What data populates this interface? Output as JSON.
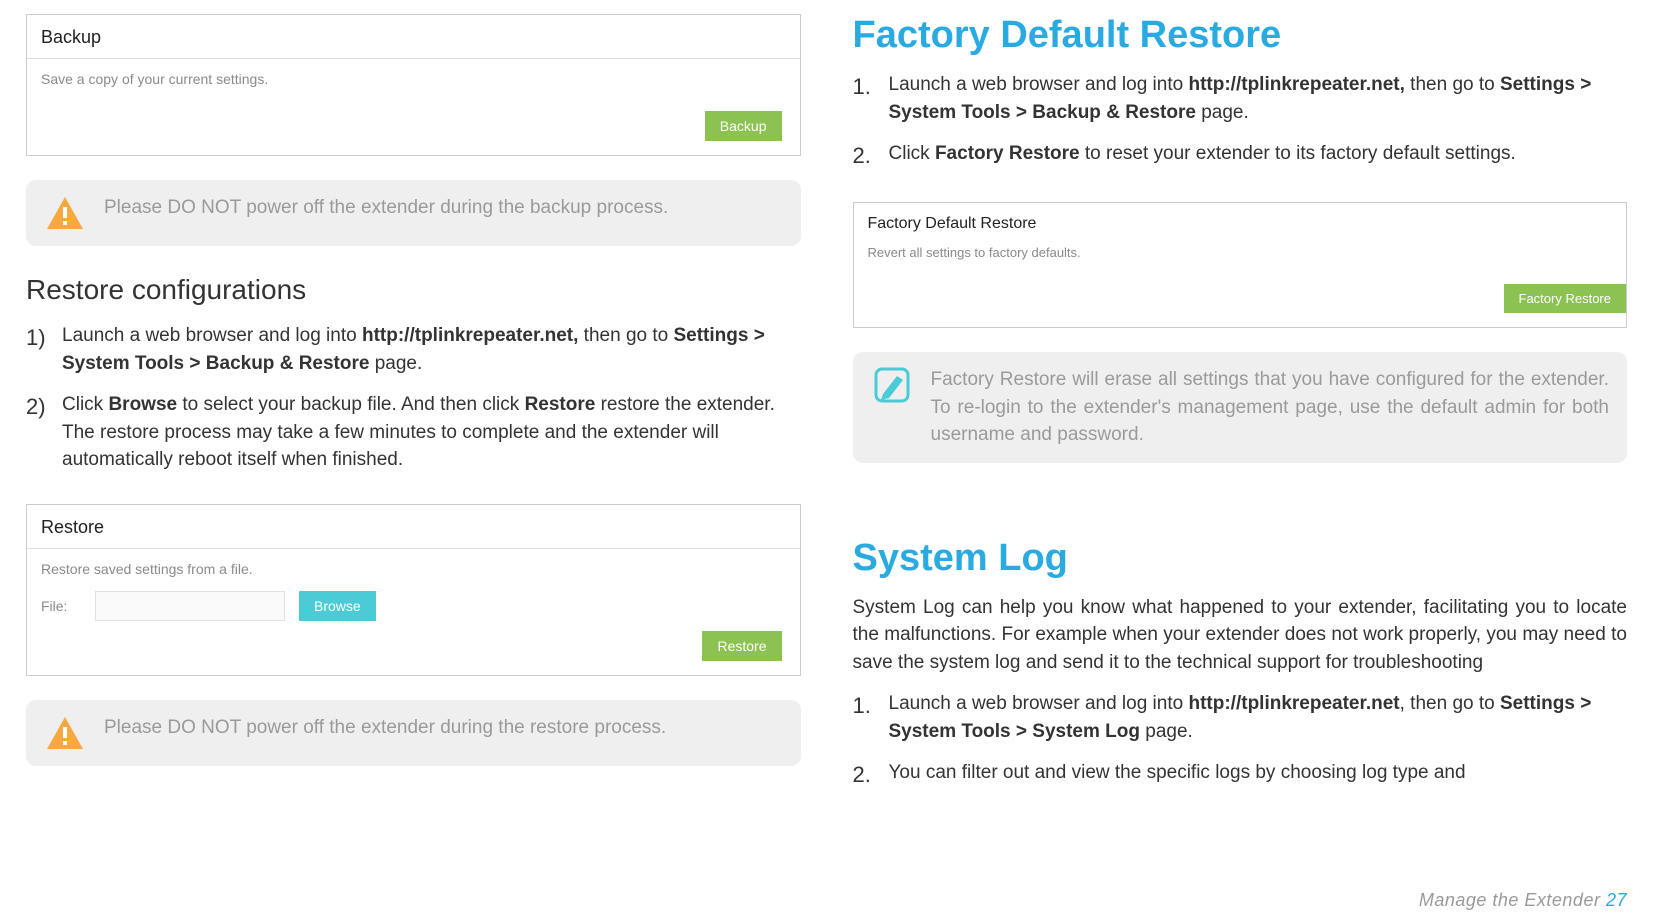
{
  "left": {
    "backup_panel": {
      "header": "Backup",
      "desc": "Save a copy of your current settings.",
      "button": "Backup"
    },
    "backup_warning": "Please DO NOT power off the extender during the backup process.",
    "restore_heading": "Restore configurations",
    "restore_steps": {
      "s1_num": "1)",
      "s1_a": "Launch a web browser and log into ",
      "s1_url": "http://tplinkrepeater.net,",
      "s1_b": " then go to ",
      "s1_path": "Settings > System Tools > Backup & Restore",
      "s1_c": " page.",
      "s2_num": "2)",
      "s2_a": "Click ",
      "s2_b1": "Browse",
      "s2_c": " to select your backup file. And then click ",
      "s2_b2": "Restore",
      "s2_d": " restore the extender. The restore process may take a few minutes to complete and the extender will automatically reboot itself when finished."
    },
    "restore_panel": {
      "header": "Restore",
      "desc": "Restore saved settings from a file.",
      "file_label": "File:",
      "browse": "Browse",
      "restore": "Restore"
    },
    "restore_warning": "Please DO NOT power off the extender during the restore process."
  },
  "right": {
    "fdr_heading": "Factory Default Restore",
    "fdr_steps": {
      "s1_num": "1.",
      "s1_a": "Launch a web browser and log into ",
      "s1_url": "http://tplinkrepeater.net,",
      "s1_b": " then go to ",
      "s1_path": "Settings > System Tools > Backup & Restore",
      "s1_c": " page.",
      "s2_num": "2.",
      "s2_a": "Click ",
      "s2_b1": "Factory Restore",
      "s2_c": " to reset your extender to its factory default settings."
    },
    "fdr_panel": {
      "header": "Factory Default Restore",
      "desc": "Revert all settings to factory defaults.",
      "button": "Factory Restore"
    },
    "fdr_note": "Factory Restore will erase all settings that you have configured for the extender. To re-login to the extender's management page, use the default admin for both username and password.",
    "syslog_heading": "System Log",
    "syslog_desc": "System Log can help you know what happened to your extender, facilitating you to locate the malfunctions. For example when your extender does not work properly, you may need to save the system log and send it to the technical support for troubleshooting",
    "syslog_steps": {
      "s1_num": "1.",
      "s1_a": "Launch a web browser and log into ",
      "s1_url": "http://tplinkrepeater.net",
      "s1_b": ", then go to ",
      "s1_path": "Settings > System Tools > System Log",
      "s1_c": " page.",
      "s2_num": "2.",
      "s2_a": "You can filter out and view the specific logs by choosing log type and"
    }
  },
  "footer": {
    "label": "Manage  the  Extender",
    "page": "27"
  }
}
